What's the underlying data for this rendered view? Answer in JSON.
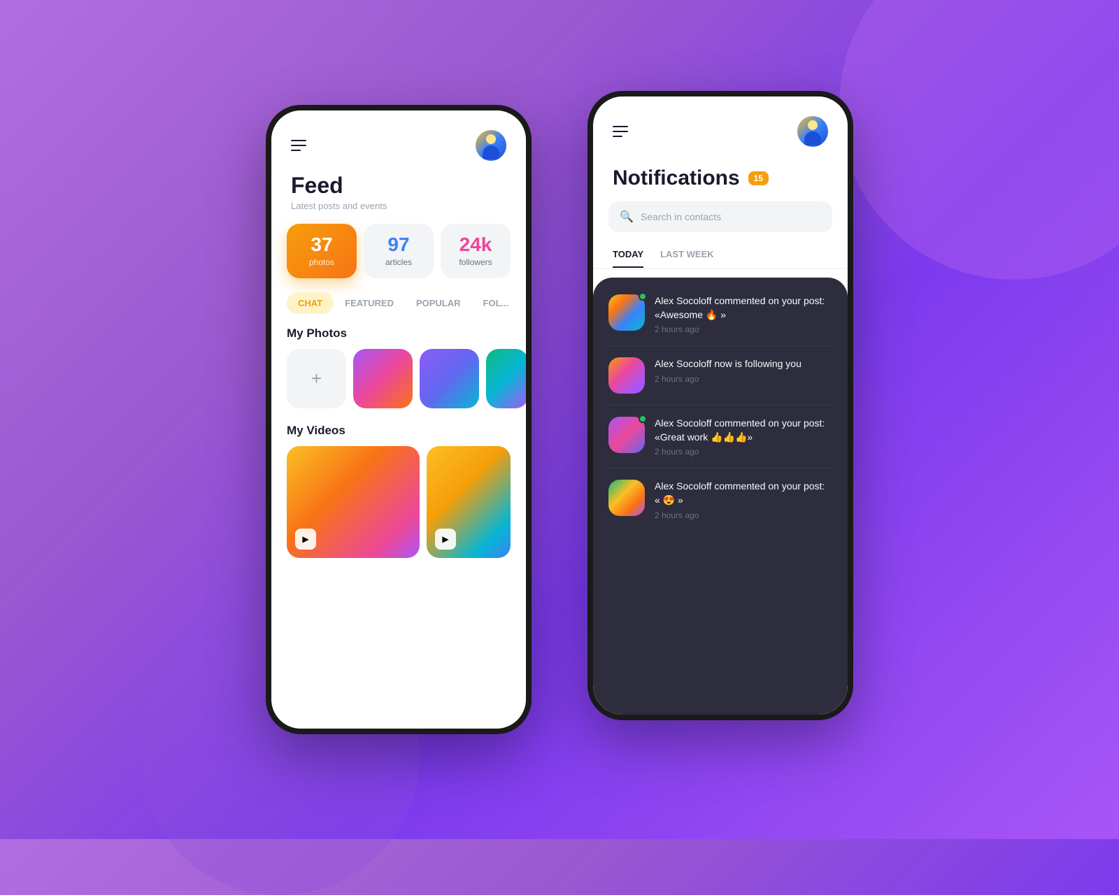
{
  "background": {
    "color": "#9b59d0"
  },
  "phone1": {
    "header": {
      "menu_label": "menu",
      "avatar_alt": "user avatar"
    },
    "feed": {
      "title": "Feed",
      "subtitle": "Latest posts and events"
    },
    "stats": [
      {
        "number": "37",
        "label": "photos",
        "style": "orange"
      },
      {
        "number": "97",
        "label": "articles",
        "style": "light"
      },
      {
        "number": "24k",
        "label": "followers",
        "style": "light"
      }
    ],
    "tabs": [
      {
        "label": "CHAT",
        "active": true
      },
      {
        "label": "FEATURED",
        "active": false
      },
      {
        "label": "POPULAR",
        "active": false
      },
      {
        "label": "FOL...",
        "active": false
      }
    ],
    "photos_section": {
      "title": "My Photos",
      "add_label": "+"
    },
    "videos_section": {
      "title": "My Videos"
    }
  },
  "phone2": {
    "header": {
      "menu_label": "menu",
      "avatar_alt": "user avatar"
    },
    "notifications": {
      "title": "Notifications",
      "badge": "15"
    },
    "search": {
      "placeholder": "Search in contacts"
    },
    "tabs": [
      {
        "label": "TODAY",
        "active": true
      },
      {
        "label": "LAST WEEK",
        "active": false
      }
    ],
    "notifications_list": [
      {
        "id": 1,
        "text": "Alex Socoloff commented on your post: «Awesome 🔥 »",
        "time": "2 hours ago",
        "has_online": true
      },
      {
        "id": 2,
        "text": "Alex Socoloff now is following you",
        "time": "2 hours ago",
        "has_online": false
      },
      {
        "id": 3,
        "text": "Alex Socoloff commented on your post: «Great work 👍👍👍»",
        "time": "2 hours ago",
        "has_online": true
      },
      {
        "id": 4,
        "text": "Alex Socoloff commented on your post: « 😍 »",
        "time": "2 hours ago",
        "has_online": false
      }
    ]
  }
}
